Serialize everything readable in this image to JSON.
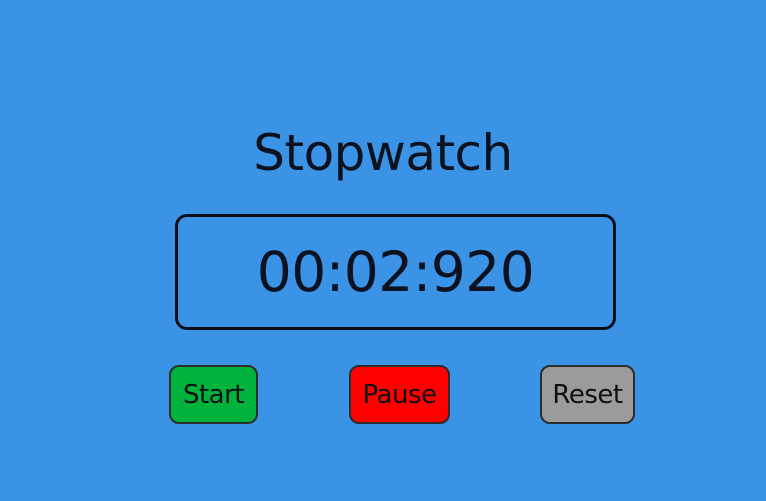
{
  "app": {
    "title": "Stopwatch"
  },
  "display": {
    "time": "00:02:920"
  },
  "controls": {
    "start_label": "Start",
    "pause_label": "Pause",
    "reset_label": "Reset"
  },
  "colors": {
    "background": "#3b93e6",
    "start": "#00b33c",
    "pause": "#ff0000",
    "reset": "#9b9b9b",
    "text": "#0d1220"
  }
}
